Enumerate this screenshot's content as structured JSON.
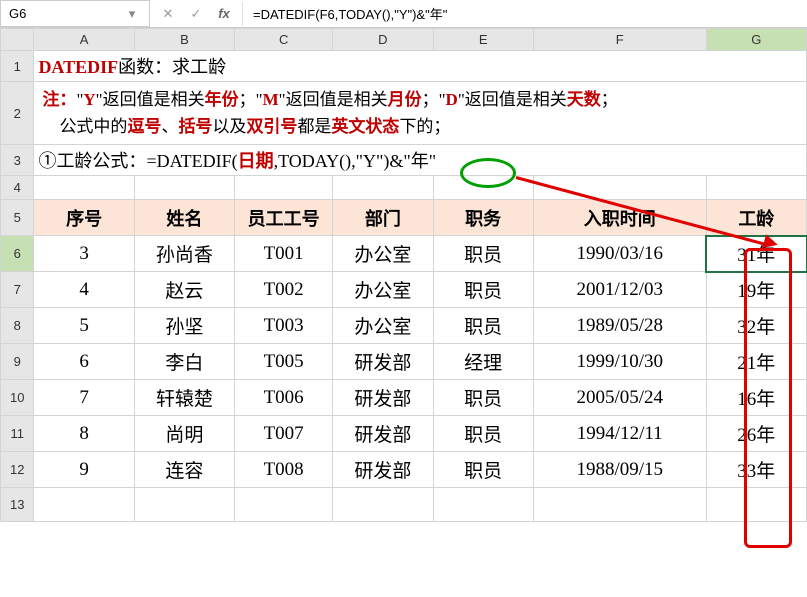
{
  "nameBox": "G6",
  "formula": "=DATEDIF(F6,TODAY(),\"Y\")&\"年\"",
  "title": {
    "fn": "DATEDIF",
    "rest": "函数：求工龄"
  },
  "note": {
    "pre": "注：",
    "q1": "\"",
    "y": "Y",
    "q2": "\"",
    "t1": "返回值是相关",
    "nianfen": "年份",
    "t2": "；",
    "q3": "\"",
    "m": "M",
    "q4": "\"",
    "t3": "返回值是相关",
    "yuefen": "月份",
    "t4": "；",
    "q5": "\"",
    "d": "D",
    "q6": "\"",
    "t5": "返回值是相关",
    "tianshu": "天数",
    "t6": "；",
    "line2a": "公式中的",
    "douhao": "逗号",
    "line2b": "、",
    "kuohao": "括号",
    "line2c": "以及",
    "shuang": "双引号",
    "line2d": "都是",
    "yingwen": "英文状态",
    "line2e": "下的；"
  },
  "formulaRow": {
    "num": "①",
    "label": "工龄公式：",
    "eq": "=DATEDIF(",
    "arg1": "日期",
    ",": "",
    "today": "TODAY()",
    ",2": ",",
    "q1": "\"",
    "y": "Y",
    "q2": "\"",
    ")": ")",
    "amp": "&",
    "q3": "\"",
    "nian": "年",
    "q4": "\""
  },
  "headers": {
    "seq": "序号",
    "name": "姓名",
    "empid": "员工工号",
    "dept": "部门",
    "pos": "职务",
    "hiredate": "入职时间",
    "tenure": "工龄"
  },
  "rows": [
    {
      "seq": "3",
      "name": "孙尚香",
      "empid": "T001",
      "dept": "办公室",
      "pos": "职员",
      "hiredate": "1990/03/16",
      "tenure": "31年"
    },
    {
      "seq": "4",
      "name": "赵云",
      "empid": "T002",
      "dept": "办公室",
      "pos": "职员",
      "hiredate": "2001/12/03",
      "tenure": "19年"
    },
    {
      "seq": "5",
      "name": "孙坚",
      "empid": "T003",
      "dept": "办公室",
      "pos": "职员",
      "hiredate": "1989/05/28",
      "tenure": "32年"
    },
    {
      "seq": "6",
      "name": "李白",
      "empid": "T005",
      "dept": "研发部",
      "pos": "经理",
      "hiredate": "1999/10/30",
      "tenure": "21年"
    },
    {
      "seq": "7",
      "name": "轩辕楚",
      "empid": "T006",
      "dept": "研发部",
      "pos": "职员",
      "hiredate": "2005/05/24",
      "tenure": "16年"
    },
    {
      "seq": "8",
      "name": "尚明",
      "empid": "T007",
      "dept": "研发部",
      "pos": "职员",
      "hiredate": "1994/12/11",
      "tenure": "26年"
    },
    {
      "seq": "9",
      "name": "连容",
      "empid": "T008",
      "dept": "研发部",
      "pos": "职员",
      "hiredate": "1988/09/15",
      "tenure": "33年"
    }
  ],
  "cols": [
    "A",
    "B",
    "C",
    "D",
    "E",
    "F",
    "G"
  ],
  "rowNums": [
    "1",
    "2",
    "3",
    "4",
    "5",
    "6",
    "7",
    "8",
    "9",
    "10",
    "11",
    "12",
    "13"
  ],
  "chevron": "▾",
  "cancel": "✕",
  "confirm": "✓",
  "fx": "fx"
}
